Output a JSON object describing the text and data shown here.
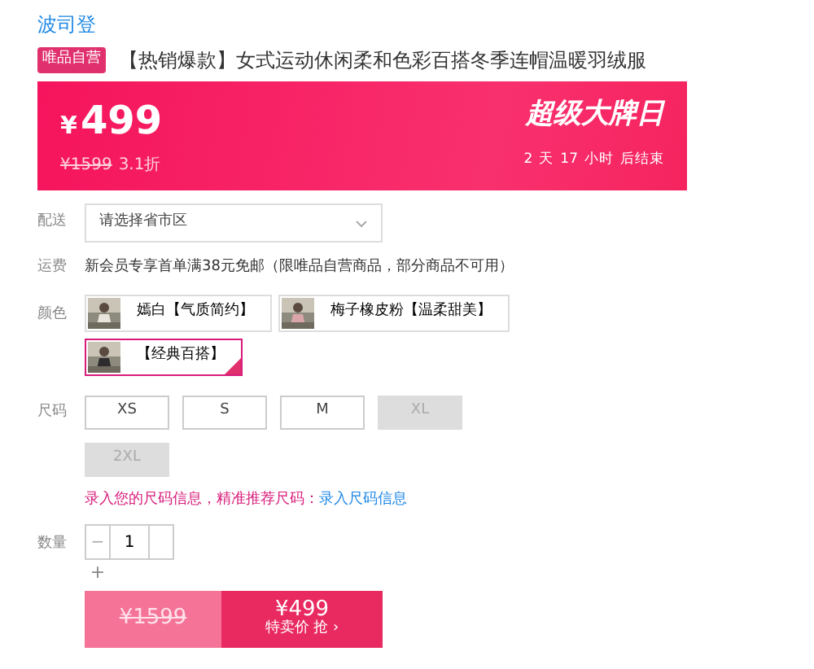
{
  "brand_link": "波司登",
  "product": {
    "badge": "唯品自营",
    "title": "【热销爆款】女式运动休闲柔和色彩百搭冬季连帽温暖羽绒服"
  },
  "price_banner": {
    "price_symbol": "¥",
    "price": "499",
    "original_price": "¥1599",
    "discount": "3.1折",
    "event": "超级大牌日",
    "countdown": [
      "2",
      "天",
      "17",
      "小时",
      "后结束"
    ]
  },
  "delivery": {
    "label": "配送",
    "placeholder": "请选择省市区"
  },
  "shipping": {
    "label": "运费",
    "text": "新会员专享首单满38元免邮（限唯品自营商品，部分商品不可用）"
  },
  "colors": {
    "label": "颜色",
    "options": [
      {
        "text": "嫣白【气质简约】",
        "selected": false
      },
      {
        "text": "梅子橡皮粉【温柔甜美】",
        "selected": false
      },
      {
        "text": "【经典百搭】",
        "selected": true
      }
    ]
  },
  "sizes": {
    "label": "尺码",
    "options": [
      {
        "text": "XS",
        "disabled": false
      },
      {
        "text": "S",
        "disabled": false
      },
      {
        "text": "M",
        "disabled": false
      },
      {
        "text": "XL",
        "disabled": true
      },
      {
        "text": "2XL",
        "disabled": true
      }
    ]
  },
  "size_hint": {
    "text": "录入您的尺码信息，精准推荐尺码：",
    "link": "录入尺码信息"
  },
  "quantity": {
    "label": "数量",
    "minus": "−",
    "value": "1",
    "plus": "+"
  },
  "buy": {
    "original_price": "¥1599",
    "price": "¥499",
    "action": "特卖价 抢 ›"
  }
}
